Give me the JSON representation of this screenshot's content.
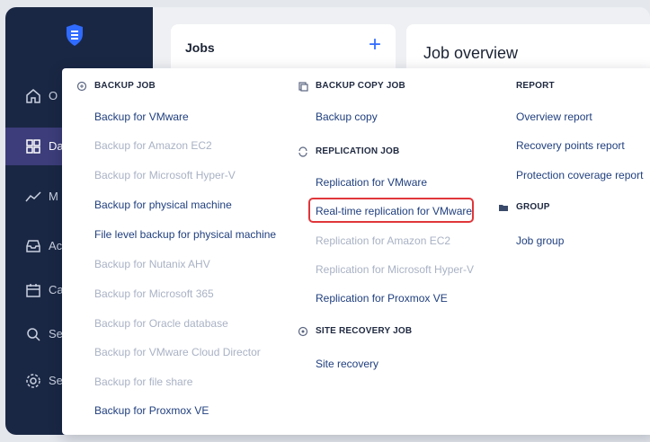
{
  "sidebar": {
    "items": [
      {
        "icon": "home-icon",
        "label": "O"
      },
      {
        "icon": "dashboard-icon",
        "label": "Da"
      },
      {
        "icon": "monitor-chart-icon",
        "label": "M"
      },
      {
        "icon": "inbox-icon",
        "label": "Ac"
      },
      {
        "icon": "calendar-icon",
        "label": "Ca"
      },
      {
        "icon": "search-icon",
        "label": "Se"
      },
      {
        "icon": "settings-icon",
        "label": "Se"
      }
    ]
  },
  "jobs_panel": {
    "title": "Jobs",
    "add_label": "+"
  },
  "overview": {
    "title": "Job overview"
  },
  "menu": {
    "backup": {
      "title": "BACKUP JOB",
      "items": [
        "Backup for VMware",
        "Backup for Amazon EC2",
        "Backup for Microsoft Hyper-V",
        "Backup for physical machine",
        "File level backup for physical machine",
        "Backup for Nutanix AHV",
        "Backup for Microsoft 365",
        "Backup for Oracle database",
        "Backup for VMware Cloud Director",
        "Backup for file share",
        "Backup for Proxmox VE"
      ]
    },
    "backup_copy": {
      "title": "BACKUP COPY JOB",
      "items": [
        "Backup copy"
      ]
    },
    "replication": {
      "title": "REPLICATION JOB",
      "items": [
        "Replication for VMware",
        "Real-time replication for VMware",
        "Replication for Amazon EC2",
        "Replication for Microsoft Hyper-V",
        "Replication for Proxmox VE"
      ]
    },
    "site_recovery": {
      "title": "SITE RECOVERY JOB",
      "items": [
        "Site recovery"
      ]
    },
    "report": {
      "title": "REPORT",
      "items": [
        "Overview report",
        "Recovery points report",
        "Protection coverage report"
      ]
    },
    "group": {
      "title": "GROUP",
      "items": [
        "Job group"
      ]
    }
  },
  "colors": {
    "sidebar_bg": "#1a2744",
    "active_nav": "#3c3d7a",
    "accent": "#2f6bff",
    "link": "#21407f",
    "disabled": "#a9b2c4",
    "highlight": "#e0363a"
  }
}
